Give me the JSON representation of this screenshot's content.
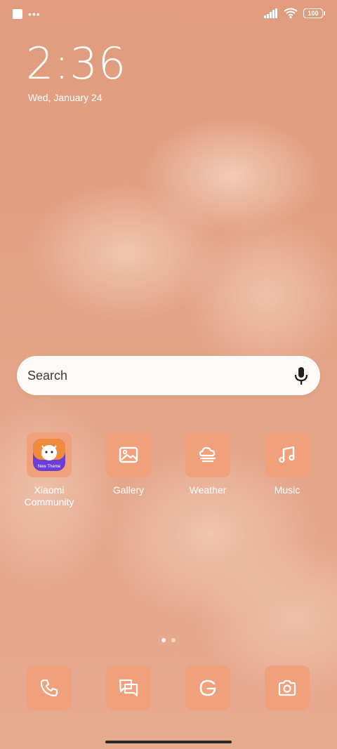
{
  "status_bar": {
    "battery_level": "100",
    "signal": "full",
    "wifi": "connected"
  },
  "lockscreen": {
    "time": "2:36",
    "date": "Wed, January 24"
  },
  "search": {
    "placeholder": "Search"
  },
  "apps": [
    {
      "label": "Xiaomi Community",
      "icon": "xiaomi-community-icon",
      "badge_text": "New Theme"
    },
    {
      "label": "Gallery",
      "icon": "gallery-icon"
    },
    {
      "label": "Weather",
      "icon": "weather-icon"
    },
    {
      "label": "Music",
      "icon": "music-icon"
    }
  ],
  "dock": [
    {
      "label": "Phone",
      "icon": "phone-icon"
    },
    {
      "label": "Messages",
      "icon": "messages-icon"
    },
    {
      "label": "Google",
      "icon": "google-icon"
    },
    {
      "label": "Camera",
      "icon": "camera-icon"
    }
  ],
  "pages": {
    "count": 2,
    "current": 1
  },
  "colors": {
    "tile": "#f1a07c",
    "background": "#e29f80",
    "text": "#ffffff"
  }
}
